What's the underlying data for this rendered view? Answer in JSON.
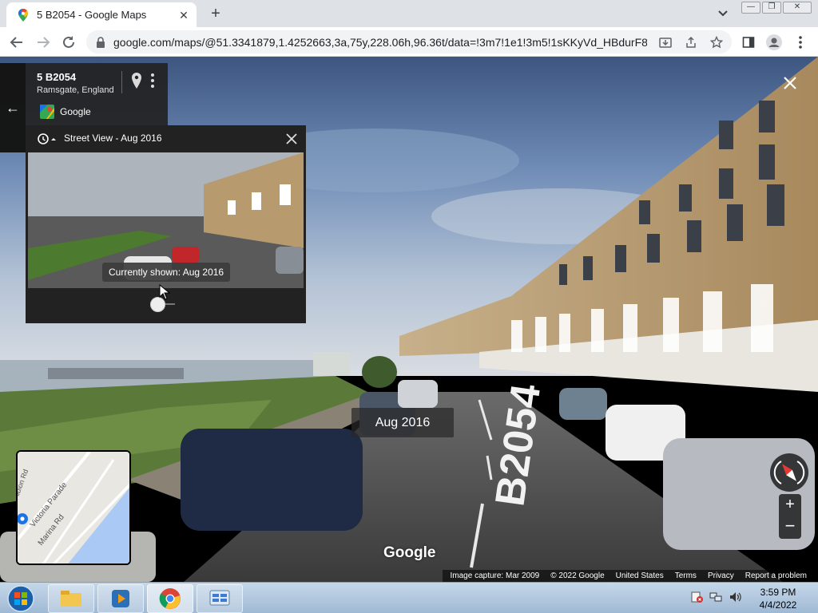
{
  "browser": {
    "tab_title": "5 B2054 - Google Maps",
    "url": "google.com/maps/@51.3341879,1.4252663,3a,75y,228.06h,96.36t/data=!3m7!1e1!3m5!1sKKyVd_HBdurF8H..."
  },
  "streetview": {
    "address_street": "5 B2054",
    "address_city": "Ramsgate, England",
    "provider": "Google",
    "timemachine_title": "Street View - Aug 2016",
    "tooltip": "Currently shown: Aug 2016",
    "date_badge": "Aug 2016",
    "watermark": "Google",
    "road_marking": "B2054",
    "map_labels": [
      "Victoria Parade",
      "Marina Rd",
      "Albion Rd"
    ]
  },
  "footer": {
    "capture": "Image capture: Mar 2009",
    "copyright": "© 2022 Google",
    "region": "United States",
    "terms": "Terms",
    "privacy": "Privacy",
    "report": "Report a problem"
  },
  "taskbar": {
    "time": "3:59 PM",
    "date": "4/4/2022"
  },
  "colors": {
    "accent_blue": "#1a73e8",
    "sky": "#8ea8c8",
    "panel": "#222222"
  }
}
